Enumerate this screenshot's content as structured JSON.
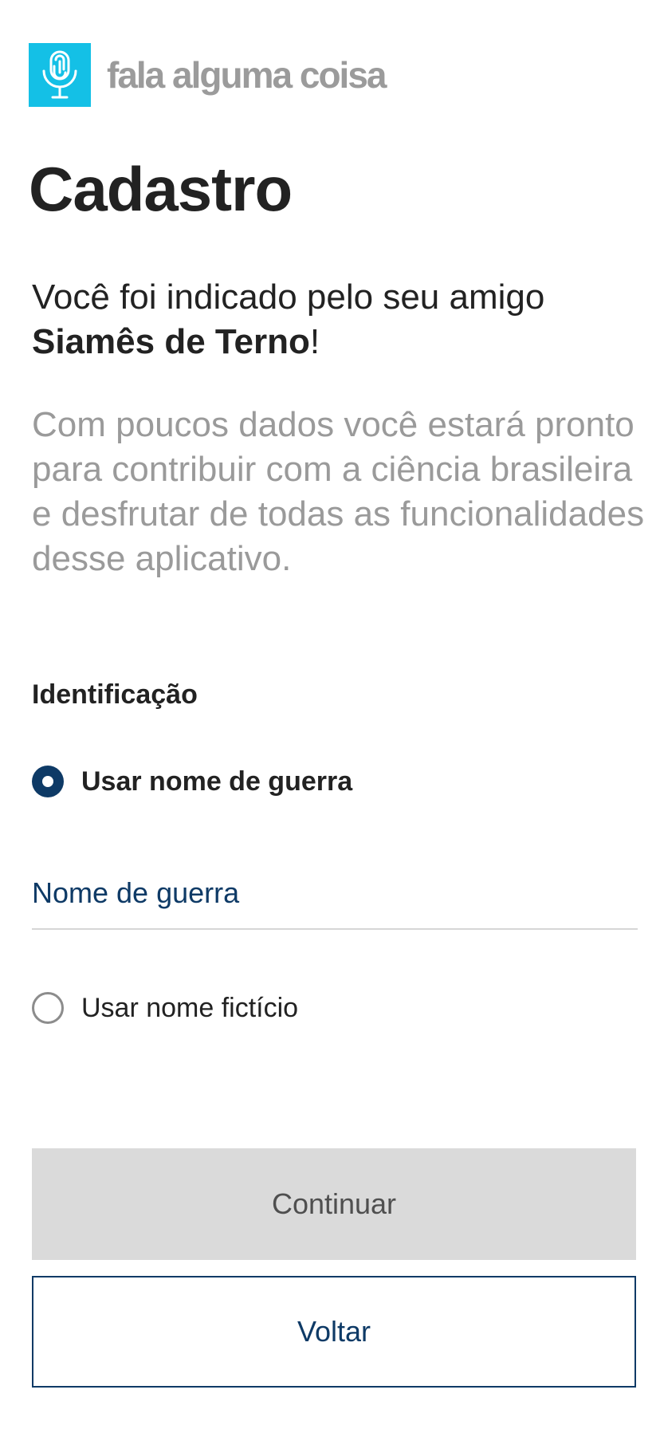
{
  "brand": {
    "name": "fala alguma coisa",
    "logo_icon": "microphone-fingerprint-icon",
    "logo_color": "#14c0e6"
  },
  "page": {
    "title": "Cadastro"
  },
  "intro": {
    "text": "Você foi indicado pelo seu amigo ",
    "friend_name": "Siamês de Terno",
    "suffix": "!"
  },
  "description": "Com poucos dados você estará pronto para contribuir com a ciência brasileira e desfrutar de todas as funcionalidades desse aplicativo.",
  "identification": {
    "section_title": "Identificação",
    "options": [
      {
        "label": "Usar nome de guerra",
        "selected": true
      },
      {
        "label": "Usar nome fictício",
        "selected": false
      }
    ],
    "nickname_field": {
      "placeholder": "Nome de guerra",
      "value": ""
    }
  },
  "actions": {
    "continue_label": "Continuar",
    "back_label": "Voltar"
  },
  "colors": {
    "accent": "#0e3a66",
    "logo": "#14c0e6",
    "disabled_button": "#dadada",
    "muted_text": "#9a9a9a"
  }
}
